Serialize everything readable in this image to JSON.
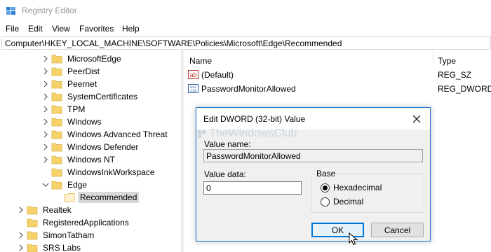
{
  "window": {
    "title": "Registry Editor",
    "icon": "registry-icon"
  },
  "menu": [
    "File",
    "Edit",
    "View",
    "Favorites",
    "Help"
  ],
  "address": "Computer\\HKEY_LOCAL_MACHINE\\SOFTWARE\\Policies\\Microsoft\\Edge\\Recommended",
  "tree": [
    {
      "label": "MicrosoftEdge",
      "level": 3,
      "expander": "collapsed"
    },
    {
      "label": "PeerDist",
      "level": 3,
      "expander": "collapsed"
    },
    {
      "label": "Peernet",
      "level": 3,
      "expander": "collapsed"
    },
    {
      "label": "SystemCertificates",
      "level": 3,
      "expander": "collapsed"
    },
    {
      "label": "TPM",
      "level": 3,
      "expander": "collapsed"
    },
    {
      "label": "Windows",
      "level": 3,
      "expander": "collapsed"
    },
    {
      "label": "Windows Advanced Threat",
      "level": 3,
      "expander": "collapsed"
    },
    {
      "label": "Windows Defender",
      "level": 3,
      "expander": "collapsed"
    },
    {
      "label": "Windows NT",
      "level": 3,
      "expander": "collapsed"
    },
    {
      "label": "WindowsInkWorkspace",
      "level": 3,
      "expander": "none"
    },
    {
      "label": "Edge",
      "level": 3,
      "expander": "expanded"
    },
    {
      "label": "Recommended",
      "level": 4,
      "expander": "none",
      "selected": true
    },
    {
      "label": "Realtek",
      "level": 2,
      "expander": "collapsed"
    },
    {
      "label": "RegisteredApplications",
      "level": 2,
      "expander": "none"
    },
    {
      "label": "SimonTatham",
      "level": 2,
      "expander": "collapsed"
    },
    {
      "label": "SRS Labs",
      "level": 2,
      "expander": "collapsed"
    }
  ],
  "list": {
    "columns": {
      "name": "Name",
      "type": "Type"
    },
    "rows": [
      {
        "name": "(Default)",
        "type": "REG_SZ",
        "icon": "string-value-icon"
      },
      {
        "name": "PasswordMonitorAllowed",
        "type": "REG_DWORD",
        "icon": "binary-value-icon"
      }
    ]
  },
  "dialog": {
    "title": "Edit DWORD (32-bit) Value",
    "watermark": "TheWindowsClub",
    "value_name_label": "Value name:",
    "value_name": "PasswordMonitorAllowed",
    "value_data_label": "Value data:",
    "value_data": "0",
    "base_label": "Base",
    "base_options": [
      {
        "label": "Hexadecimal",
        "checked": true
      },
      {
        "label": "Decimal",
        "checked": false
      }
    ],
    "ok_label": "OK",
    "cancel_label": "Cancel"
  },
  "colors": {
    "folder": "#f6d26a",
    "accent": "#0078d7",
    "selection": "#d9d9d9"
  }
}
